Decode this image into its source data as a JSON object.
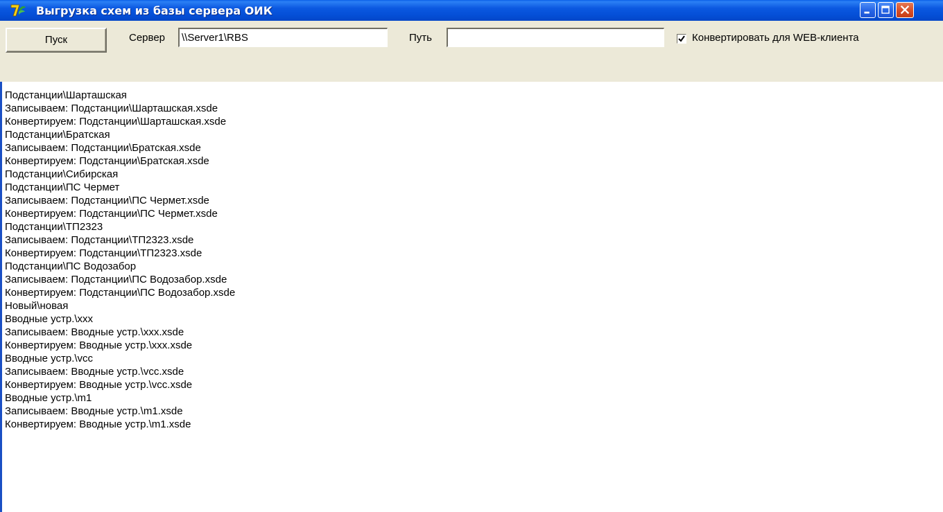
{
  "window": {
    "title": "Выгрузка схем из базы сервера ОИК",
    "app_icon": "app-logo-icon",
    "controls": [
      "minimize-icon",
      "maximize-icon",
      "close-icon"
    ]
  },
  "toolbar": {
    "start_label": "Пуск",
    "server_label": "Сервер",
    "server_value": "\\\\Server1\\RBS",
    "path_label": "Путь",
    "path_value": "",
    "convert_label": "Конвертировать для WEB-клиента",
    "convert_checked": true
  },
  "log": {
    "lines": [
      "Подстанции\\Шарташская",
      "Записываем: Подстанции\\Шарташская.xsde",
      "Конвертируем: Подстанции\\Шарташская.xsde",
      "Подстанции\\Братская",
      "Записываем: Подстанции\\Братская.xsde",
      "Конвертируем: Подстанции\\Братская.xsde",
      "Подстанции\\Сибирская",
      "Подстанции\\ПС Чермет",
      "Записываем: Подстанции\\ПС Чермет.xsde",
      "Конвертируем: Подстанции\\ПС Чермет.xsde",
      "Подстанции\\ТП2323",
      "Записываем: Подстанции\\ТП2323.xsde",
      "Конвертируем: Подстанции\\ТП2323.xsde",
      "Подстанции\\ПС Водозабор",
      "Записываем: Подстанции\\ПС Водозабор.xsde",
      "Конвертируем: Подстанции\\ПС Водозабор.xsde",
      "Новый\\новая",
      "Вводные устр.\\xxx",
      "Записываем: Вводные устр.\\xxx.xsde",
      "Конвертируем: Вводные устр.\\xxx.xsde",
      "Вводные устр.\\vcc",
      "Записываем: Вводные устр.\\vcc.xsde",
      "Конвертируем: Вводные устр.\\vcc.xsde",
      "Вводные устр.\\m1",
      "Записываем: Вводные устр.\\m1.xsde",
      "Конвертируем: Вводные устр.\\m1.xsde"
    ]
  },
  "colors": {
    "titlebar": "#0550d8",
    "face": "#ece9d8",
    "close": "#d8502a"
  }
}
